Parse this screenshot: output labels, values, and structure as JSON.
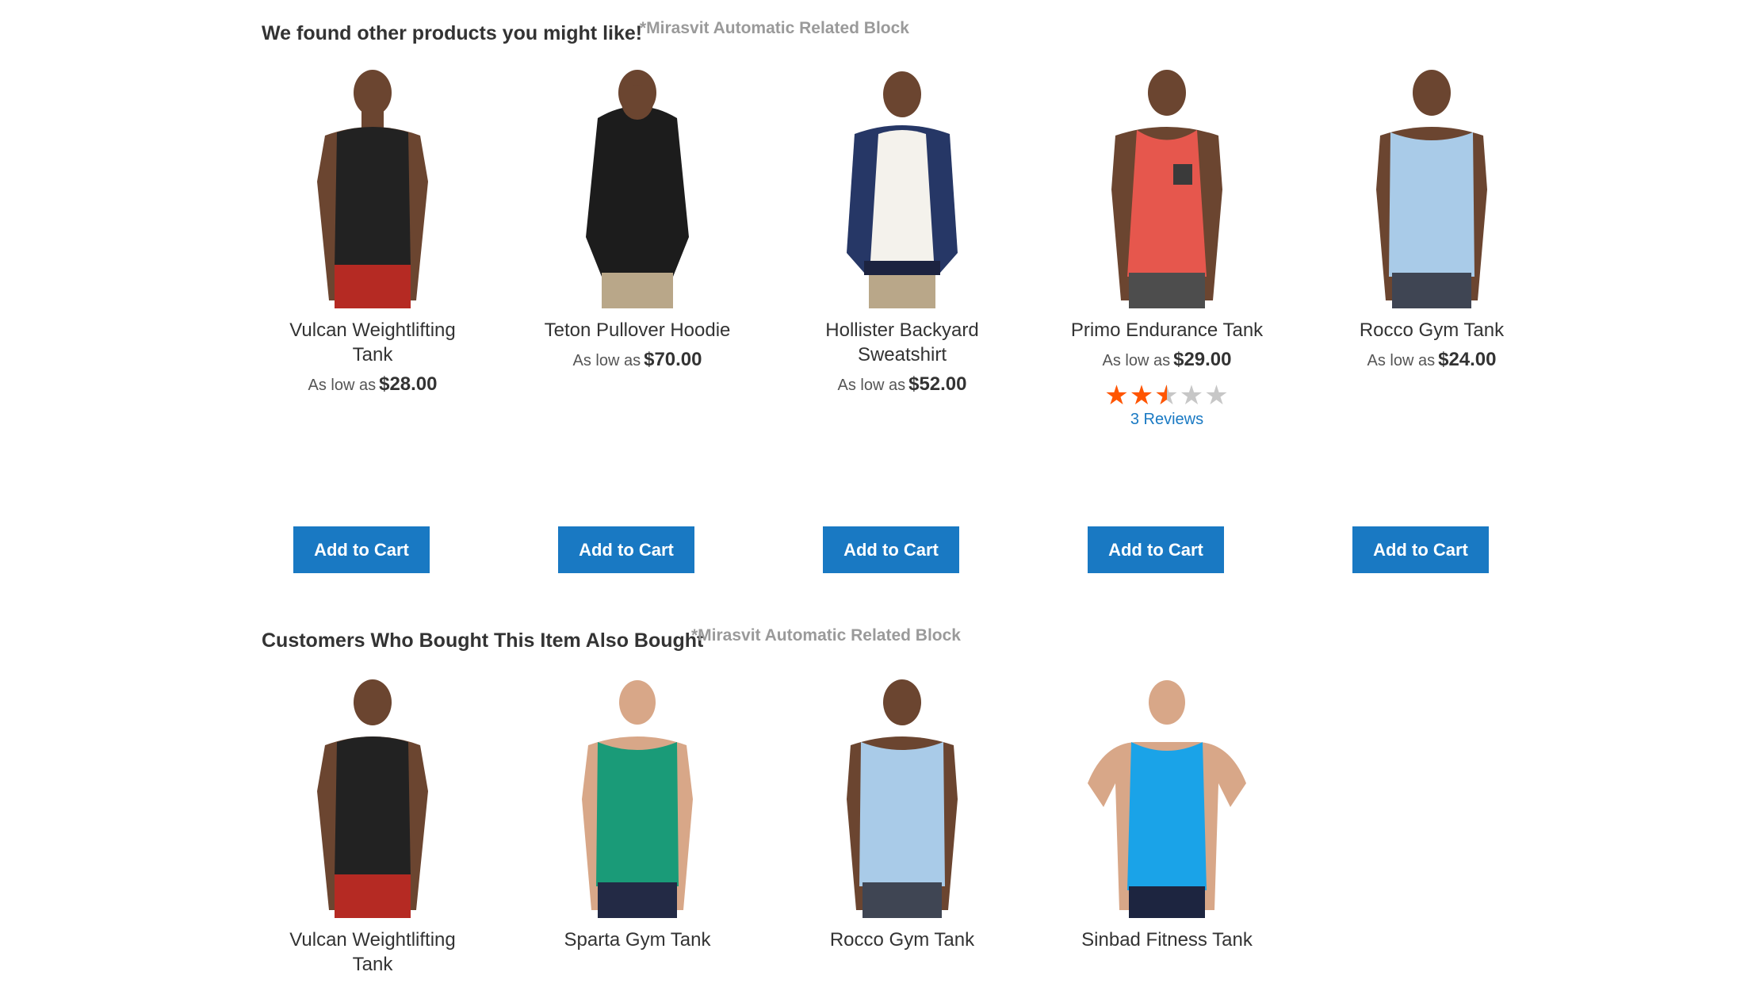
{
  "section1": {
    "title": "We found other products you might like!",
    "note": "*Mirasvit Automatic Related Block",
    "products": [
      {
        "name": "Vulcan Weightlifting Tank",
        "price_prefix": "As low as",
        "price": "$28.00",
        "button": "Add to Cart"
      },
      {
        "name": "Teton Pullover Hoodie",
        "price_prefix": "As low as",
        "price": "$70.00",
        "button": "Add to Cart"
      },
      {
        "name": "Hollister Backyard Sweatshirt",
        "price_prefix": "As low as",
        "price": "$52.00",
        "button": "Add to Cart"
      },
      {
        "name": "Primo Endurance Tank",
        "price_prefix": "As low as",
        "price": "$29.00",
        "rating": 2.5,
        "reviews": "3  Reviews",
        "button": "Add to Cart"
      },
      {
        "name": "Rocco Gym Tank",
        "price_prefix": "As low as",
        "price": "$24.00",
        "button": "Add to Cart"
      }
    ]
  },
  "section2": {
    "title": "Customers Who Bought This Item Also Bought",
    "note": "*Mirasvit Automatic Related Block",
    "products": [
      {
        "name": "Vulcan Weightlifting Tank"
      },
      {
        "name": "Sparta Gym Tank"
      },
      {
        "name": "Rocco Gym Tank"
      },
      {
        "name": "Sinbad Fitness Tank"
      }
    ]
  },
  "colors": {
    "button": "#1979c3",
    "star": "#ff5501",
    "note": "#9a9a9a"
  }
}
